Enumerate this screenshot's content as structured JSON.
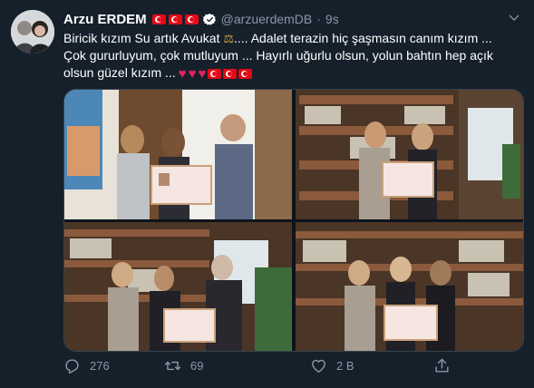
{
  "tweet": {
    "author_name": "Arzu ERDEM",
    "handle": "@arzuerdemDB",
    "separator": "·",
    "time": "9s",
    "line1": "Biricik kızım Su artık Avukat",
    "line1b": ".... Adalet terazin hiç şaşmasın canım kızım ...",
    "line2": "Çok gururluyum, çok mutluyum ... Hayırlı uğurlu olsun, yolun bahtın hep açık",
    "line3": "olsun  güzel kızım ...",
    "emoji": {
      "scale": "balance-scale-emoji",
      "heart": "♥"
    }
  },
  "actions": {
    "reply_count": "276",
    "retweet_count": "69",
    "like_count": "2 B"
  },
  "colors": {
    "background": "#15202b",
    "secondary_text": "#8899a6",
    "verified_blue": "#1da1f2",
    "turkish_red": "#e30a17",
    "heart_red": "#e0245e"
  },
  "icons": [
    "verified-badge-icon",
    "caret-down-icon",
    "reply-icon",
    "retweet-icon",
    "like-icon",
    "share-icon",
    "turkey-flag-icon",
    "heart-icon",
    "balance-scale-icon"
  ]
}
